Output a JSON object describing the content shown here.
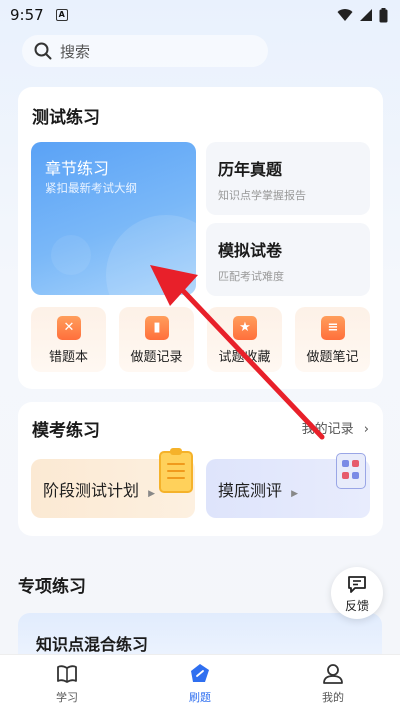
{
  "status": {
    "time": "9:57",
    "notif": "A"
  },
  "search": {
    "placeholder": "搜索"
  },
  "practice": {
    "title": "测试练习",
    "chapter": {
      "title": "章节练习",
      "subtitle": "紧扣最新考试大纲"
    },
    "history": {
      "title": "历年真题",
      "subtitle": "知识点学掌握报告"
    },
    "mock_paper": {
      "title": "模拟试卷",
      "subtitle": "匹配考试难度"
    },
    "buttons": [
      {
        "label": "错题本",
        "icon": "wrong-book-icon",
        "glyph": "✕"
      },
      {
        "label": "做题记录",
        "icon": "record-icon",
        "glyph": "▮"
      },
      {
        "label": "试题收藏",
        "icon": "star-icon",
        "glyph": "★"
      },
      {
        "label": "做题笔记",
        "icon": "note-icon",
        "glyph": "≡"
      }
    ]
  },
  "mock": {
    "title": "模考练习",
    "record_link": "我的记录",
    "tiles": [
      {
        "label": "阶段测试计划",
        "icon": "clipboard-icon"
      },
      {
        "label": "摸底测评",
        "icon": "test-sheet-icon"
      }
    ]
  },
  "special": {
    "title": "专项练习",
    "card_title": "知识点混合练习"
  },
  "feedback": {
    "label": "反馈"
  },
  "tabs": [
    {
      "label": "学习",
      "icon": "book-icon"
    },
    {
      "label": "刷题",
      "icon": "brush-icon",
      "active": true
    },
    {
      "label": "我的",
      "icon": "person-icon"
    }
  ],
  "colors": {
    "accent": "#2f6ff0",
    "chapter_tile": "#5aa2f6",
    "arrow": "#e8202a"
  }
}
